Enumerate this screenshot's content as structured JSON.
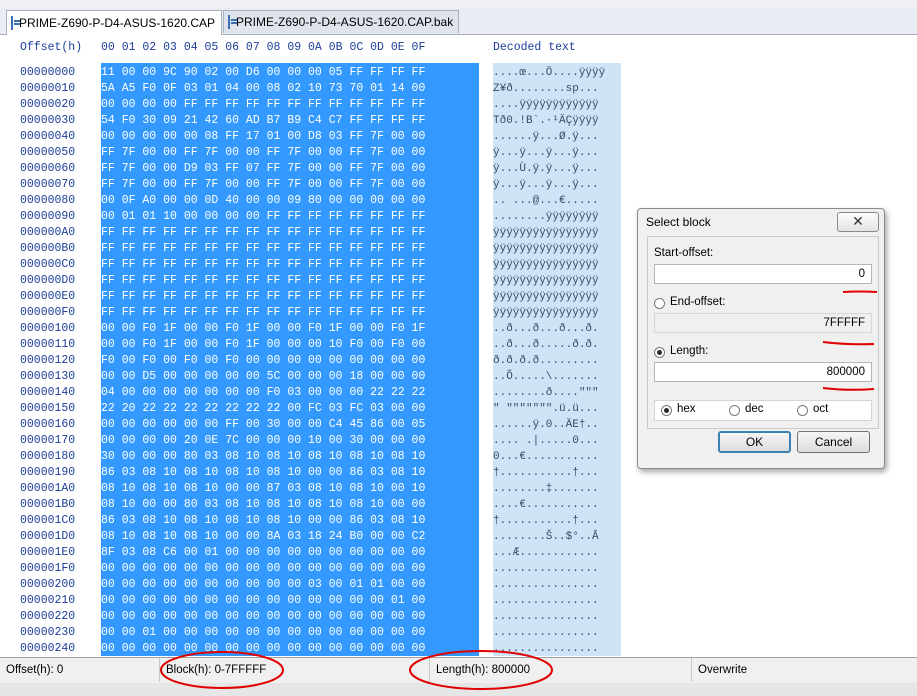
{
  "tabs": [
    {
      "label": "PRIME-Z690-P-D4-ASUS-1620.CAP",
      "active": true
    },
    {
      "label": "PRIME-Z690-P-D4-ASUS-1620.CAP.bak",
      "active": false
    }
  ],
  "editor": {
    "offset_header": "Offset(h)",
    "column_header": "00 01 02 03 04 05 06 07 08 09 0A 0B 0C 0D 0E 0F",
    "decoded_header": "Decoded text",
    "rows": [
      {
        "offset": "00000000",
        "hex": "11 00 00 9C 90 02 00 D6 00 00 00 05 FF FF FF FF",
        "text": "....œ...Ö....ÿÿÿÿ"
      },
      {
        "offset": "00000010",
        "hex": "5A A5 F0 0F 03 01 04 00 08 02 10 73 70 01 14 00",
        "text": "Z¥ð........sp..."
      },
      {
        "offset": "00000020",
        "hex": "00 00 00 00 FF FF FF FF FF FF FF FF FF FF FF FF",
        "text": "....ÿÿÿÿÿÿÿÿÿÿÿÿ"
      },
      {
        "offset": "00000030",
        "hex": "54 F0 30 09 21 42 60 AD B7 B9 C4 C7 FF FF FF FF",
        "text": "Tð0.!B`.·¹ÄÇÿÿÿÿ"
      },
      {
        "offset": "00000040",
        "hex": "00 00 00 00 00 08 FF 17 01 00 D8 03 FF 7F 00 00",
        "text": "......ÿ...Ø.ÿ..."
      },
      {
        "offset": "00000050",
        "hex": "FF 7F 00 00 FF 7F 00 00 FF 7F 00 00 FF 7F 00 00",
        "text": "ÿ...ÿ...ÿ...ÿ..."
      },
      {
        "offset": "00000060",
        "hex": "FF 7F 00 00 D9 03 FF 07 FF 7F 00 00 FF 7F 00 00",
        "text": "ÿ...Ù.ÿ.ÿ...ÿ..."
      },
      {
        "offset": "00000070",
        "hex": "FF 7F 00 00 FF 7F 00 00 FF 7F 00 00 FF 7F 00 00",
        "text": "ÿ...ÿ...ÿ...ÿ..."
      },
      {
        "offset": "00000080",
        "hex": "00 0F A0 00 00 0D 40 00 00 09 80 00 00 00 00 00",
        "text": ".. ...@...€....."
      },
      {
        "offset": "00000090",
        "hex": "00 01 01 10 00 00 00 00 FF FF FF FF FF FF FF FF",
        "text": "........ÿÿÿÿÿÿÿÿ"
      },
      {
        "offset": "000000A0",
        "hex": "FF FF FF FF FF FF FF FF FF FF FF FF FF FF FF FF",
        "text": "ÿÿÿÿÿÿÿÿÿÿÿÿÿÿÿÿ"
      },
      {
        "offset": "000000B0",
        "hex": "FF FF FF FF FF FF FF FF FF FF FF FF FF FF FF FF",
        "text": "ÿÿÿÿÿÿÿÿÿÿÿÿÿÿÿÿ"
      },
      {
        "offset": "000000C0",
        "hex": "FF FF FF FF FF FF FF FF FF FF FF FF FF FF FF FF",
        "text": "ÿÿÿÿÿÿÿÿÿÿÿÿÿÿÿÿ"
      },
      {
        "offset": "000000D0",
        "hex": "FF FF FF FF FF FF FF FF FF FF FF FF FF FF FF FF",
        "text": "ÿÿÿÿÿÿÿÿÿÿÿÿÿÿÿÿ"
      },
      {
        "offset": "000000E0",
        "hex": "FF FF FF FF FF FF FF FF FF FF FF FF FF FF FF FF",
        "text": "ÿÿÿÿÿÿÿÿÿÿÿÿÿÿÿÿ"
      },
      {
        "offset": "000000F0",
        "hex": "FF FF FF FF FF FF FF FF FF FF FF FF FF FF FF FF",
        "text": "ÿÿÿÿÿÿÿÿÿÿÿÿÿÿÿÿ"
      },
      {
        "offset": "00000100",
        "hex": "00 00 F0 1F 00 00 F0 1F 00 00 F0 1F 00 00 F0 1F",
        "text": "..ð...ð...ð...ð."
      },
      {
        "offset": "00000110",
        "hex": "00 00 F0 1F 00 00 F0 1F 00 00 00 10 F0 00 F0 00",
        "text": "..ð...ð.....ð.ð."
      },
      {
        "offset": "00000120",
        "hex": "F0 00 F0 00 F0 00 F0 00 00 00 00 00 00 00 00 00",
        "text": "ð.ð.ð.ð........."
      },
      {
        "offset": "00000130",
        "hex": "00 00 D5 00 00 00 00 00 5C 00 00 00 18 00 00 00",
        "text": "..Õ.....\\......."
      },
      {
        "offset": "00000140",
        "hex": "04 00 00 00 00 00 00 00 F0 03 00 00 00 22 22 22",
        "text": "........ð....\"\"\""
      },
      {
        "offset": "00000150",
        "hex": "22 20 22 22 22 22 22 22 22 00 FC 03 FC 03 00 00",
        "text": "\" \"\"\"\"\"\"\".ü.ü..."
      },
      {
        "offset": "00000160",
        "hex": "00 00 00 00 00 00 FF 00 30 00 00 C4 45 86 00 05",
        "text": "......ÿ.0..ÄE†.."
      },
      {
        "offset": "00000170",
        "hex": "00 00 00 00 20 0E 7C 00 00 00 10 00 30 00 00 00",
        "text": ".... .|.....0..."
      },
      {
        "offset": "00000180",
        "hex": "30 00 00 00 80 03 08 10 08 10 08 10 08 10 08 10",
        "text": "0...€..........."
      },
      {
        "offset": "00000190",
        "hex": "86 03 08 10 08 10 08 10 08 10 00 00 86 03 08 10",
        "text": "†...........†..."
      },
      {
        "offset": "000001A0",
        "hex": "08 10 08 10 08 10 00 00 87 03 08 10 08 10 00 10",
        "text": "........‡......."
      },
      {
        "offset": "000001B0",
        "hex": "08 10 00 00 80 03 08 10 08 10 08 10 08 10 00 00",
        "text": "....€..........."
      },
      {
        "offset": "000001C0",
        "hex": "86 03 08 10 08 10 08 10 08 10 00 00 86 03 08 10",
        "text": "†...........†..."
      },
      {
        "offset": "000001D0",
        "hex": "08 10 08 10 08 10 00 00 8A 03 18 24 B0 00 00 C2",
        "text": "........Š..$°..Â"
      },
      {
        "offset": "000001E0",
        "hex": "8F 03 08 C6 00 01 00 00 00 00 00 00 00 00 00 00",
        "text": "...Æ............"
      },
      {
        "offset": "000001F0",
        "hex": "00 00 00 00 00 00 00 00 00 00 00 00 00 00 00 00",
        "text": "................"
      },
      {
        "offset": "00000200",
        "hex": "00 00 00 00 00 00 00 00 00 00 03 00 01 01 00 00",
        "text": "................"
      },
      {
        "offset": "00000210",
        "hex": "00 00 00 00 00 00 00 00 00 00 00 00 00 00 01 00",
        "text": "................"
      },
      {
        "offset": "00000220",
        "hex": "00 00 00 00 00 00 00 00 00 00 00 00 00 00 00 00",
        "text": "................"
      },
      {
        "offset": "00000230",
        "hex": "00 00 01 00 00 00 00 00 00 00 00 00 00 00 00 00",
        "text": "................"
      },
      {
        "offset": "00000240",
        "hex": "00 00 00 00 00 00 00 00 00 00 00 00 00 00 00 00",
        "text": "................"
      }
    ]
  },
  "dialog": {
    "title": "Select block",
    "close_glyph": "✕",
    "start_label": "Start-offset:",
    "start_value": "0",
    "end_label": "End-offset:",
    "end_value": "7FFFFF",
    "length_label": "Length:",
    "length_value": "800000",
    "selected_mode": "length",
    "bases": [
      {
        "label": "hex",
        "checked": true
      },
      {
        "label": "dec",
        "checked": false
      },
      {
        "label": "oct",
        "checked": false
      }
    ],
    "ok_label": "OK",
    "cancel_label": "Cancel"
  },
  "status": {
    "offset": "Offset(h): 0",
    "block": "Block(h): 0-7FFFFF",
    "length": "Length(h): 800000",
    "mode": "Overwrite"
  },
  "colors": {
    "selection": "#3399ff",
    "text_selection": "#cfe3f7",
    "annotation": "#e00000"
  }
}
